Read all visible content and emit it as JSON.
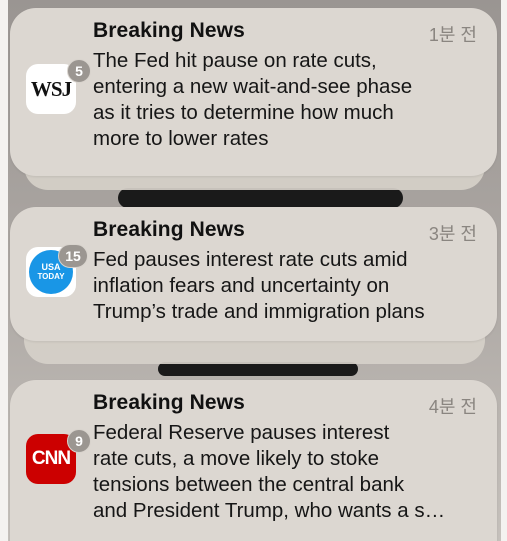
{
  "notifications": [
    {
      "app": "WSJ",
      "icon_text": "WSJ",
      "badge": "5",
      "title": "Breaking News",
      "time": "1분 전",
      "body_lines": [
        "The Fed hit pause on rate cuts,",
        "entering a new wait-and-see phase",
        "as it tries to determine how much",
        "more to lower rates"
      ]
    },
    {
      "app": "USA TODAY",
      "icon_text_top": "USA",
      "icon_text_bottom": "TODAY",
      "badge": "15",
      "title": "Breaking News",
      "time": "3분 전",
      "body_lines": [
        "Fed pauses interest rate cuts amid",
        "inflation fears and uncertainty on",
        "Trump’s trade and immigration plans"
      ]
    },
    {
      "app": "CNN",
      "icon_text": "CNN",
      "badge": "9",
      "title": "Breaking News",
      "time": "4분 전",
      "body_lines": [
        "Federal Reserve pauses interest",
        "rate cuts, a move likely to stoke",
        "tensions between the central bank",
        "and President Trump, who wants a s…"
      ]
    }
  ],
  "colors": {
    "card": "#dcd7d1",
    "wsj_icon_bg": "#ffffff",
    "usa_today_blue": "#1996e6",
    "cnn_red": "#cc0000",
    "badge": "#9b9691"
  }
}
